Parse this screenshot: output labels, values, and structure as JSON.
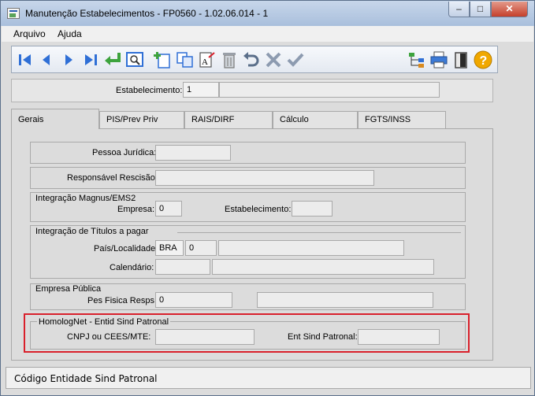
{
  "window": {
    "title": "Manutenção Estabelecimentos - FP0560 - 1.02.06.014 - 1"
  },
  "window_controls": {
    "minimize": "–",
    "maximize": "□",
    "close": "✕"
  },
  "menu": [
    {
      "label": "Arquivo"
    },
    {
      "label": "Ajuda"
    }
  ],
  "toolbar": {
    "icons": [
      "first-icon",
      "prev-icon",
      "next-icon",
      "last-icon",
      "goto-icon",
      "zoom-icon",
      "add-icon",
      "copy-icon",
      "edit-icon",
      "delete-icon",
      "undo-icon",
      "cancel-icon",
      "confirm-icon",
      "tree-icon",
      "print-icon",
      "exit-icon",
      "help-icon"
    ]
  },
  "header": {
    "estabelecimento_label": "Estabelecimento:",
    "estabelecimento_value": "1",
    "estabelecimento_desc": ""
  },
  "tabs": [
    {
      "label": "Gerais"
    },
    {
      "label": "PIS/Prev Priv"
    },
    {
      "label": "RAIS/DIRF"
    },
    {
      "label": "Cálculo"
    },
    {
      "label": "FGTS/INSS"
    }
  ],
  "gerais": {
    "pessoa_juridica_label": "Pessoa Jurídica:",
    "pessoa_juridica_value": "",
    "responsavel_label": "Responsável Rescisão:",
    "responsavel_value": "",
    "magnus": {
      "title": "Integração Magnus/EMS2",
      "empresa_label": "Empresa:",
      "empresa_value": "0",
      "estab_label": "Estabelecimento:",
      "estab_value": ""
    },
    "titulos": {
      "title": "Integração de Títulos a pagar",
      "pais_label": "País/Localidade:",
      "pais_value": "BRA",
      "localidade_value": "0",
      "localidade_desc": "",
      "calendario_label": "Calendário:",
      "calendario_value": "",
      "calendario_desc": ""
    },
    "empresa_publica": {
      "title": "Empresa Pública",
      "pes_fisica_label": "Pes Fisica Resps:",
      "pes_fisica_value": "0",
      "pes_fisica_desc": ""
    },
    "homolognet": {
      "title": "HomologNet - Entid Sind Patronal",
      "cnpj_label": "CNPJ ou CEES/MTE:",
      "cnpj_value": "",
      "ent_label": "Ent Sind Patronal:",
      "ent_value": ""
    }
  },
  "status": {
    "text": "Código Entidade Sind Patronal"
  },
  "colors": {
    "highlight": "#d9202b",
    "toolbar_blue": "#2f6fd6",
    "help": "#f0a800"
  }
}
